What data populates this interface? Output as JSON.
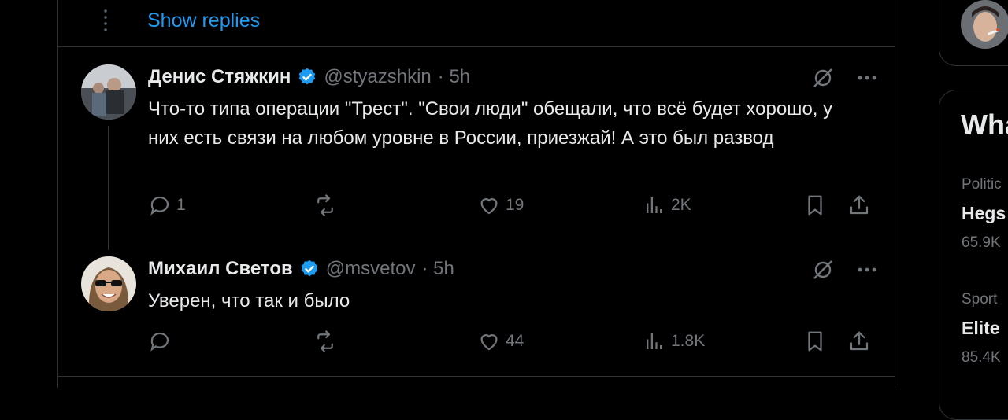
{
  "thread": {
    "show_replies_label": "Show replies"
  },
  "tweets": [
    {
      "name": "Денис Стяжкин",
      "handle": "@styazshkin",
      "time": "· 5h",
      "text": "Что-то типа операции \"Трест\". \"Свои люди\" обещали, что всё будет хорошо, у них есть связи на любом уровне в России, приезжай! А это был развод",
      "replies": "1",
      "reposts": "",
      "likes": "19",
      "views": "2K"
    },
    {
      "name": "Михаил Светов",
      "handle": "@msvetov",
      "time": "· 5h",
      "text": "Уверен, что так и было",
      "replies": "",
      "reposts": "",
      "likes": "44",
      "views": "1.8K"
    }
  ],
  "sidebar": {
    "section_title": "Wha",
    "trends": [
      {
        "category": "Politic",
        "title": "Hegs",
        "count": "65.9K"
      },
      {
        "category": "Sport",
        "title": "Elite",
        "count": "85.4K"
      }
    ]
  },
  "colors": {
    "accent": "#1d9bf0",
    "muted": "#71767b",
    "text": "#e7e9ea",
    "border": "#2f3336",
    "background": "#000000"
  }
}
